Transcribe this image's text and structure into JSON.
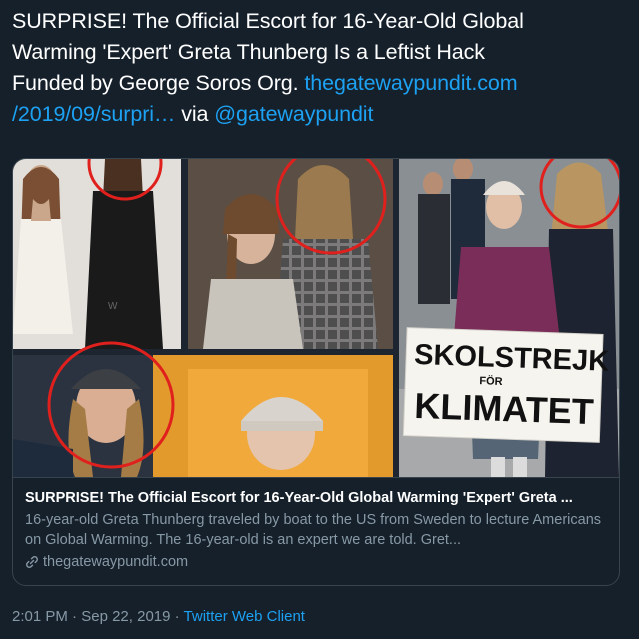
{
  "tweet": {
    "text_line1": "SURPRISE! The Official Escort for 16-Year-Old Global",
    "text_line2": "Warming 'Expert' Greta Thunberg Is a Leftist Hack",
    "text_line3a": "Funded by George Soros Org. ",
    "link_part1": "thegatewaypundit.com",
    "link_part2": "/2019/09/surpri…",
    "via_text": " via ",
    "mention": "@gatewaypundit"
  },
  "card": {
    "image_sign_line1": "SKOLSTREJK",
    "image_sign_for": "FÖR",
    "image_sign_line2": "KLIMATET",
    "title": "SURPRISE! The Official Escort for 16-Year-Old Global Warming 'Expert' Greta ...",
    "description": "16-year-old Greta Thunberg traveled by boat to the US from Sweden to lecture Americans on Global Warming. The 16-year-old is an expert we are told. Gret...",
    "domain": "thegatewaypundit.com",
    "link_icon": "link-icon"
  },
  "meta": {
    "time": "2:01 PM",
    "separator": " · ",
    "date": "Sep 22, 2019",
    "separator2": " · ",
    "client": "Twitter Web Client"
  },
  "colors": {
    "background": "#15202b",
    "link": "#1da1f2",
    "secondary_text": "#8899a6",
    "highlight_circle": "#e0201d"
  }
}
